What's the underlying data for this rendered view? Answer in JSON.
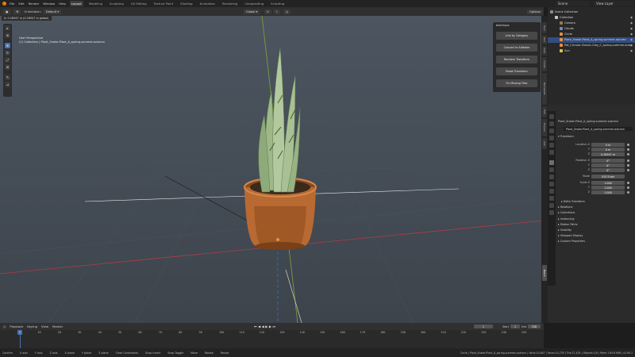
{
  "menu": [
    "File",
    "Edit",
    "Render",
    "Window",
    "Help"
  ],
  "workspaces": [
    "Layout",
    "Modeling",
    "Sculpting",
    "UV Editing",
    "Texture Paint",
    "Shading",
    "Animation",
    "Rendering",
    "Compositing",
    "Scripting"
  ],
  "active_workspace": "Layout",
  "scene": "Scene",
  "view_layer": "View Layer",
  "header": {
    "orientation_label": "Orientation:",
    "orientation_value": "Default",
    "transform_space": "Global",
    "options": "Options"
  },
  "viewport": {
    "dimension_label": "X: 0.26947 m (0.26947 m global)",
    "view_name": "User Perspective",
    "collection_info": "(1) Collection | Plant_Snake-Plant_A_spring-summer-autumn"
  },
  "batch_panel": {
    "title": "batchops",
    "buttons": [
      "Link by Category",
      "Convert to Editable",
      "Random Transform",
      "Reset Transform",
      "Fix Missing Files"
    ]
  },
  "n_panel_tabs": [
    "Item",
    "Tool",
    "View",
    "Create",
    "BlenderKit",
    "Edit",
    "Physics",
    "Add",
    "Batch"
  ],
  "outliner": {
    "rows": [
      {
        "label": "Scene Collection",
        "indent": 0,
        "selected": false,
        "color": "#8a8a8a"
      },
      {
        "label": "Collection",
        "indent": 1,
        "selected": false,
        "color": "#c8c8c8"
      },
      {
        "label": "Camera",
        "indent": 2,
        "selected": false,
        "color": "#9b7a4a"
      },
      {
        "label": "Clouds",
        "indent": 2,
        "selected": false,
        "color": "#6a8ec4"
      },
      {
        "label": "Circle",
        "indent": 2,
        "selected": false,
        "color": "#e89040"
      },
      {
        "label": "Plant_Snake-Plant_A_spring-summer-autumn",
        "indent": 2,
        "selected": true,
        "color": "#e89040"
      },
      {
        "label": "Pot_Circular-Classic-Clay_C_spring-summer-autu",
        "indent": 2,
        "selected": false,
        "color": "#e89040"
      },
      {
        "label": "Sun",
        "indent": 2,
        "selected": false,
        "color": "#d8c44a"
      }
    ]
  },
  "properties": {
    "object_name": "Plant_Snake-Plant_A_spring-summer-autumn",
    "name_field": "Plant_Snake-Plant_A_spring-summer-autumn",
    "transform_label": "Transform",
    "location": {
      "label": "Location X",
      "x": "0 m",
      "y": "0 m",
      "z": "0.26947 m"
    },
    "rotation": {
      "label": "Rotation X",
      "x": "0°",
      "y": "0°",
      "z": "0°"
    },
    "mode": {
      "label": "Mode",
      "value": "XYZ Euler"
    },
    "scale": {
      "label": "Scale X",
      "x": "1.000",
      "y": "1.000",
      "z": "1.000"
    },
    "axis_labels": [
      "Y",
      "Z"
    ],
    "sections": [
      "Delta Transform",
      "Relations",
      "Collections",
      "Instancing",
      "Motion Paths",
      "Visibility",
      "Viewport Display",
      "Custom Properties"
    ]
  },
  "timeline": {
    "menus": [
      "Playback",
      "Keying",
      "View",
      "Marker"
    ],
    "current_frame": "1",
    "start_label": "Start",
    "start": "1",
    "end_label": "End",
    "end": "250",
    "ticks": [
      "0",
      "10",
      "20",
      "30",
      "40",
      "50",
      "60",
      "70",
      "80",
      "90",
      "100",
      "110",
      "120",
      "130",
      "140",
      "150",
      "160",
      "170",
      "180",
      "190",
      "200",
      "210",
      "220",
      "230",
      "240",
      "250"
    ]
  },
  "statusbar": {
    "items": [
      "Confirm",
      "X axis",
      "Y axis",
      "Z axis",
      "X plane",
      "Y plane",
      "Z plane",
      "Clear Constraints",
      "Snap Invert",
      "Snap Toggle",
      "Move",
      "Rotate",
      "Resize"
    ],
    "right": "Circle | Plant_Snake-Plant_A_spring-summer-autumn | Verts:10,847 | Faces:14,720 | Tris:27,435 | Objects:1/6 | Mem: 194.6 MiB | v2.90.1"
  },
  "colors": {
    "accent": "#4772b3",
    "selected_row": "#334d80",
    "x_axis": "#b03c44",
    "y_axis": "#7aa83a"
  }
}
